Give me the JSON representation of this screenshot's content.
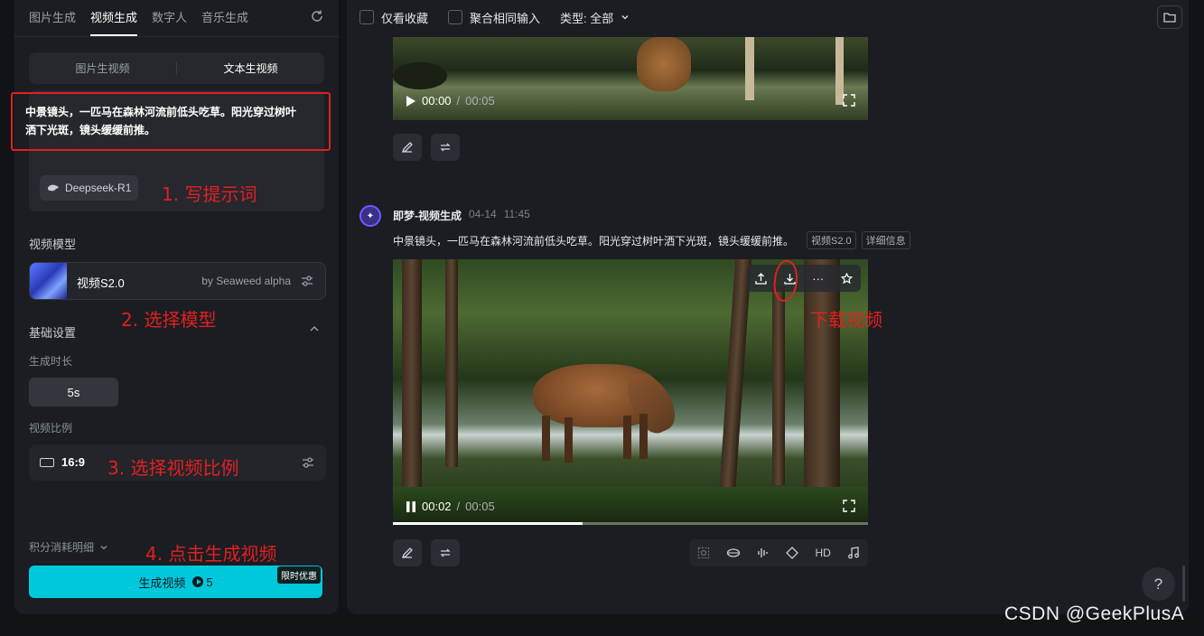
{
  "left_panel": {
    "tabs": [
      "图片生成",
      "视频生成",
      "数字人",
      "音乐生成"
    ],
    "active_tab": "视频生成",
    "mode_tabs": [
      "图片生视频",
      "文本生视频"
    ],
    "active_mode": "文本生视频",
    "prompt": "中景镜头，一匹马在森林河流前低头吃草。阳光穿过树叶洒下光斑，镜头缓缓前推。",
    "deepseek_label": "Deepseek-R1",
    "model_section_title": "视频模型",
    "model_name": "视频S2.0",
    "model_by": "by Seaweed alpha",
    "basic_settings_title": "基础设置",
    "duration_label": "生成时长",
    "duration_value": "5s",
    "ratio_label": "视频比例",
    "ratio_value": "16:9",
    "credits_label": "积分消耗明细",
    "generate_label": "生成视频",
    "generate_cost": "5",
    "promo_badge": "限时优惠"
  },
  "annotations": {
    "step1": "1. 写提示词",
    "step2": "2. 选择模型",
    "step3": "3. 选择视频比例",
    "step4": "4. 点击生成视频",
    "download": "下载视频"
  },
  "right_panel": {
    "filter_favorites": "仅看收藏",
    "filter_merge": "聚合相同输入",
    "type_filter": "类型: 全部",
    "video1": {
      "current": "00:00",
      "total": "00:05"
    },
    "message": {
      "author": "即梦-视频生成",
      "date": "04-14",
      "time": "11:45",
      "prompt": "中景镜头，一匹马在森林河流前低头吃草。阳光穿过树叶洒下光斑，镜头缓缓前推。",
      "tag_model": "视频S2.0",
      "tag_detail": "详细信息"
    },
    "video2": {
      "current": "00:02",
      "total": "00:05",
      "progress": 0.4
    },
    "tool_hd": "HD",
    "help": "?"
  },
  "watermark": "CSDN @GeekPlusA",
  "colors": {
    "accent": "#00c8dc",
    "annotation": "#e02020"
  }
}
